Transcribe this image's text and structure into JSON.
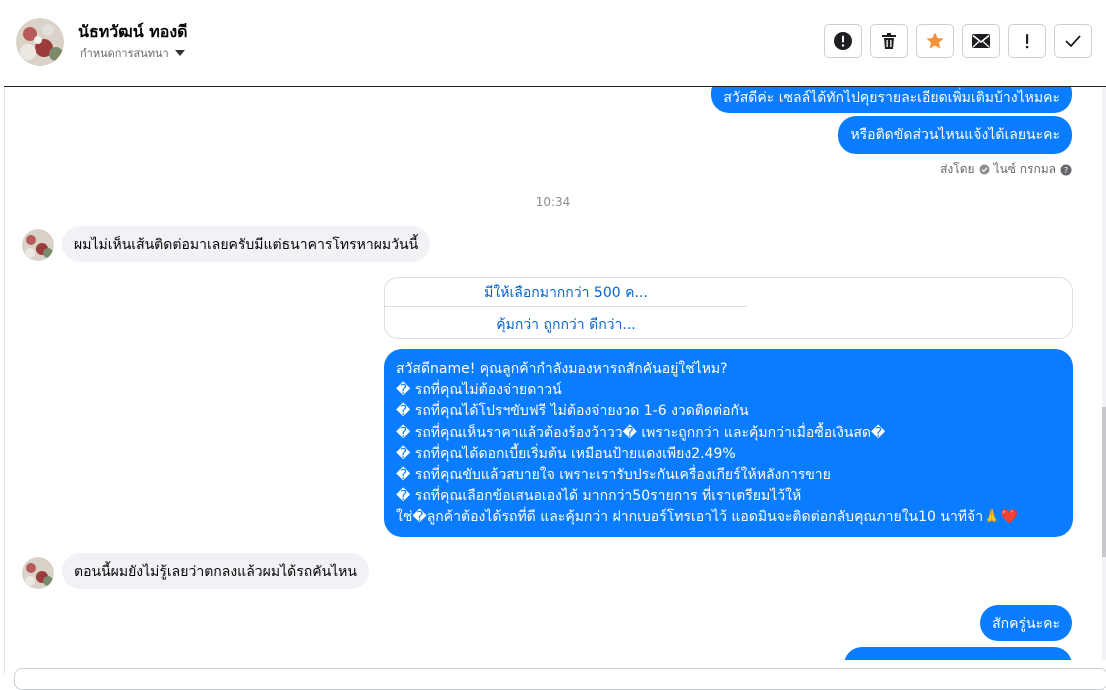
{
  "header": {
    "contact_name": "นัธทวัฒน์ ทองดี",
    "subtitle": "กำหนดการสนทนา",
    "actions": [
      {
        "name": "report-icon",
        "label": "!"
      },
      {
        "name": "trash-icon",
        "label": ""
      },
      {
        "name": "star-icon",
        "label": ""
      },
      {
        "name": "mail-icon",
        "label": ""
      },
      {
        "name": "important-icon",
        "label": "!"
      },
      {
        "name": "check-icon",
        "label": ""
      }
    ]
  },
  "messages": {
    "out_top_partial": "สวัสดีค่ะ เซลล์ได้ทักไปคุยรายละเอียดเพิ่มเติมบ้างไหมคะ",
    "out_contact_issue": "หรือติดขัดส่วนไหนแจ้งได้เลยนะคะ",
    "sent_by_label": "ส่งโดย",
    "sent_by_name": "ไนซ์ กรกมล",
    "time_1": "10:34",
    "in_1": "ผมไม่เห็นเส้นติดต่อมาเลยครับมีแต่ธนาคารโทรหาผมวันนี้",
    "card_options": [
      "มีให้เลือกมากกว่า 500 ค...",
      "คุ้มกว่า ถูกกว่า ดีกว่า..."
    ],
    "long_lines": [
      "สวัสดีname! คุณลูกค้ากำลังมองหารถสักคันอยู่ใช่ไหม?",
      "� รถที่คุณไม่ต้องจ่ายดาวน์",
      "� รถที่คุณได้โปรฯขับฟรี ไม่ต้องจ่ายงวด 1-6 งวดติดต่อกัน",
      "� รถที่คุณเห็นราคาแล้วต้องร้องว้าวว� เพราะถูกกว่า และคุ้มกว่าเมื่อซื้อเงินสด�",
      "� รถที่คุณได้ดอกเบี้ยเริ่มต้น เหมือนป้ายแดงเพียง2.49%",
      "� รถที่คุณขับแล้วสบายใจ เพราะเรารับประกันเครื่องเกียร์ให้หลังการขาย",
      "� รถที่คุณเลือกข้อเสนอเองได้ มากกว่า50รายการ ที่เราเตรียมไว้ให้",
      "ใช่�ลูกค้าต้องได้รถที่ดี และคุ้มกว่า ฝากเบอร์โทรเอาไว้ แอดมินจะติดต่อกลับคุณภายใน10 นาทีจ้า🙏❤️"
    ],
    "in_2": "ตอนนี้ผมยังไม่รู้เลยว่าตกลงแล้วผมได้รถคันไหน",
    "out_last": "สักครู่นะคะ"
  },
  "colors": {
    "outgoing_bubble": "#0a7cff",
    "incoming_bubble": "#f0f2f5",
    "star": "#f7923a"
  }
}
